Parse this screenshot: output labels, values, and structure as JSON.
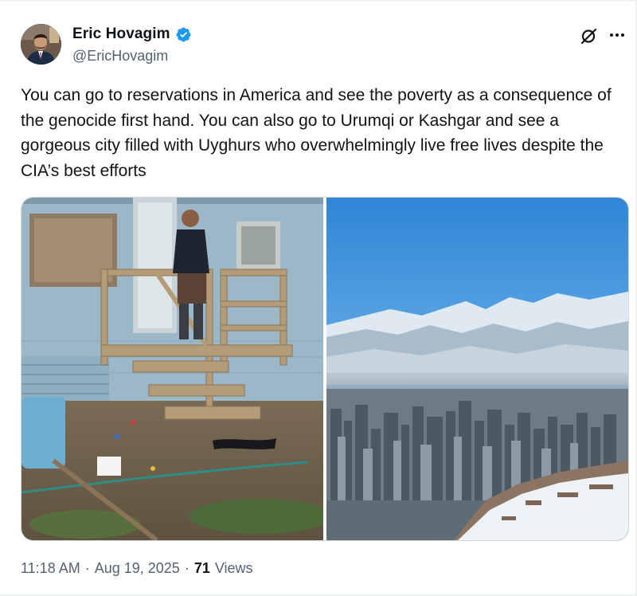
{
  "author": {
    "display_name": "Eric Hovagim",
    "handle": "@EricHovagim",
    "verified": true
  },
  "tweet": {
    "text": "You can go to reservations in America and see the poverty as a consequence of the genocide first hand. You can also go to Urumqi or Kashgar and see a gorgeous city filled with Uyghurs who overwhelmingly live free lives despite the CIA’s best efforts"
  },
  "meta": {
    "time": "11:18 AM",
    "separator": "·",
    "date": "Aug 19, 2025",
    "views_count": "71",
    "views_label": "Views"
  },
  "icons": {
    "verified": "verified-badge-icon",
    "grok": "grok-icon",
    "more": "more-options-icon"
  },
  "colors": {
    "text_primary": "#0f1419",
    "text_secondary": "#536471",
    "verified_blue": "#1d9bf0",
    "border": "#cfd9de"
  }
}
